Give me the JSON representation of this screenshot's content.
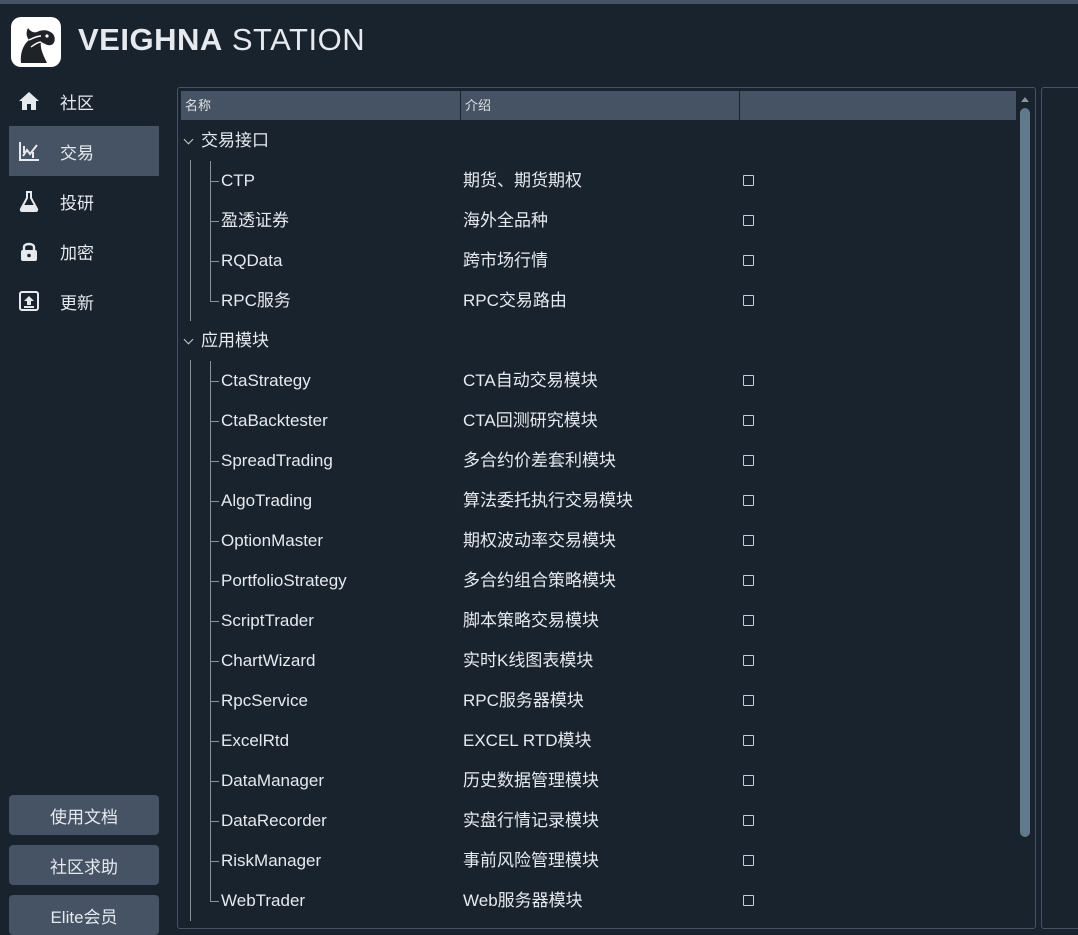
{
  "app": {
    "brand_bold": "VEIGHNA",
    "brand_light": " STATION"
  },
  "nav": [
    {
      "label": "社区",
      "icon": "home-icon"
    },
    {
      "label": "交易",
      "icon": "trading-chart-icon",
      "active": true
    },
    {
      "label": "投研",
      "icon": "flask-icon"
    },
    {
      "label": "加密",
      "icon": "lock-icon"
    },
    {
      "label": "更新",
      "icon": "upload-icon"
    }
  ],
  "sidebar_buttons": {
    "docs": "使用文档",
    "help": "社区求助",
    "elite": "Elite会员"
  },
  "table": {
    "columns": [
      "名称",
      "介绍",
      ""
    ],
    "groups": [
      {
        "name": "交易接口",
        "items": [
          {
            "name": "CTP",
            "desc": "期货、期货期权"
          },
          {
            "name": "盈透证券",
            "desc": "海外全品种"
          },
          {
            "name": "RQData",
            "desc": "跨市场行情"
          },
          {
            "name": "RPC服务",
            "desc": "RPC交易路由"
          }
        ]
      },
      {
        "name": "应用模块",
        "items": [
          {
            "name": "CtaStrategy",
            "desc": "CTA自动交易模块"
          },
          {
            "name": "CtaBacktester",
            "desc": "CTA回测研究模块"
          },
          {
            "name": "SpreadTrading",
            "desc": "多合约价差套利模块"
          },
          {
            "name": "AlgoTrading",
            "desc": "算法委托执行交易模块"
          },
          {
            "name": "OptionMaster",
            "desc": "期权波动率交易模块"
          },
          {
            "name": "PortfolioStrategy",
            "desc": "多合约组合策略模块"
          },
          {
            "name": "ScriptTrader",
            "desc": "脚本策略交易模块"
          },
          {
            "name": "ChartWizard",
            "desc": "实时K线图表模块"
          },
          {
            "name": "RpcService",
            "desc": "RPC服务器模块"
          },
          {
            "name": "ExcelRtd",
            "desc": "EXCEL RTD模块"
          },
          {
            "name": "DataManager",
            "desc": "历史数据管理模块"
          },
          {
            "name": "DataRecorder",
            "desc": "实盘行情记录模块"
          },
          {
            "name": "RiskManager",
            "desc": "事前风险管理模块"
          },
          {
            "name": "WebTrader",
            "desc": "Web服务器模块"
          }
        ]
      }
    ]
  },
  "colors": {
    "background": "#19232d",
    "panel_border": "#455364",
    "header": "#455364",
    "scrollbar_thumb": "#60798b"
  }
}
